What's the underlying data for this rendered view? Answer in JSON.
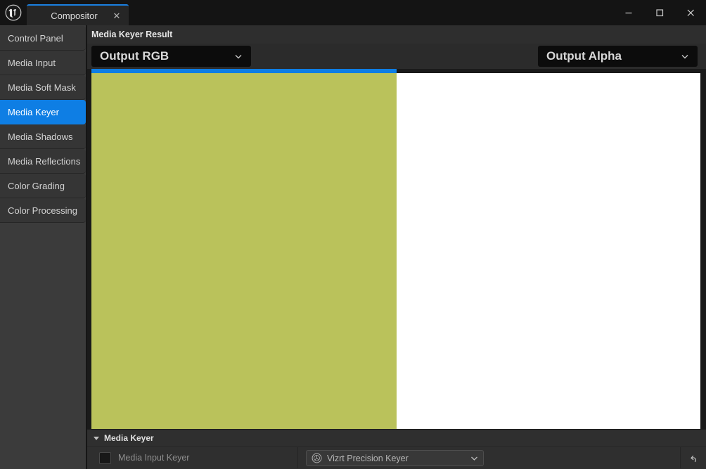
{
  "window": {
    "logo_icon": "unreal-engine-logo",
    "tab": {
      "label": "Compositor",
      "close_icon": "close-icon"
    },
    "controls": {
      "minimize_icon": "minimize-icon",
      "maximize_icon": "maximize-icon",
      "close_icon": "close-icon"
    }
  },
  "sidebar": {
    "items": [
      {
        "label": "Control Panel",
        "selected": false
      },
      {
        "label": "Media Input",
        "selected": false
      },
      {
        "label": "Media Soft Mask",
        "selected": false
      },
      {
        "label": "Media Keyer",
        "selected": true
      },
      {
        "label": "Media Shadows",
        "selected": false
      },
      {
        "label": "Media Reflections",
        "selected": false
      },
      {
        "label": "Color Grading",
        "selected": false
      },
      {
        "label": "Color Processing",
        "selected": false
      }
    ]
  },
  "main": {
    "header_title": "Media Keyer Result",
    "viewers": {
      "rgb": {
        "dropdown_label": "Output RGB",
        "caret_icon": "chevron-down-icon",
        "image_color": "#bac25b",
        "accent_color": "#0e7ee4"
      },
      "alpha": {
        "dropdown_label": "Output Alpha",
        "caret_icon": "chevron-down-icon",
        "image_color": "#ffffff"
      }
    }
  },
  "details": {
    "section": {
      "title": "Media Keyer",
      "expander_icon": "triangle-down-icon",
      "expanded": true
    },
    "row": {
      "checkbox_icon": "checkbox-unchecked",
      "label": "Media Input Keyer",
      "combo": {
        "icon": "vizrt-globe-icon",
        "value": "Vizrt Precision Keyer",
        "caret_icon": "chevron-down-icon"
      },
      "reset_icon": "reset-arrow-icon"
    }
  },
  "colors": {
    "accent": "#0e7ee4",
    "selection": "#0e7ee4",
    "keyed_rgb": "#bac25b"
  }
}
